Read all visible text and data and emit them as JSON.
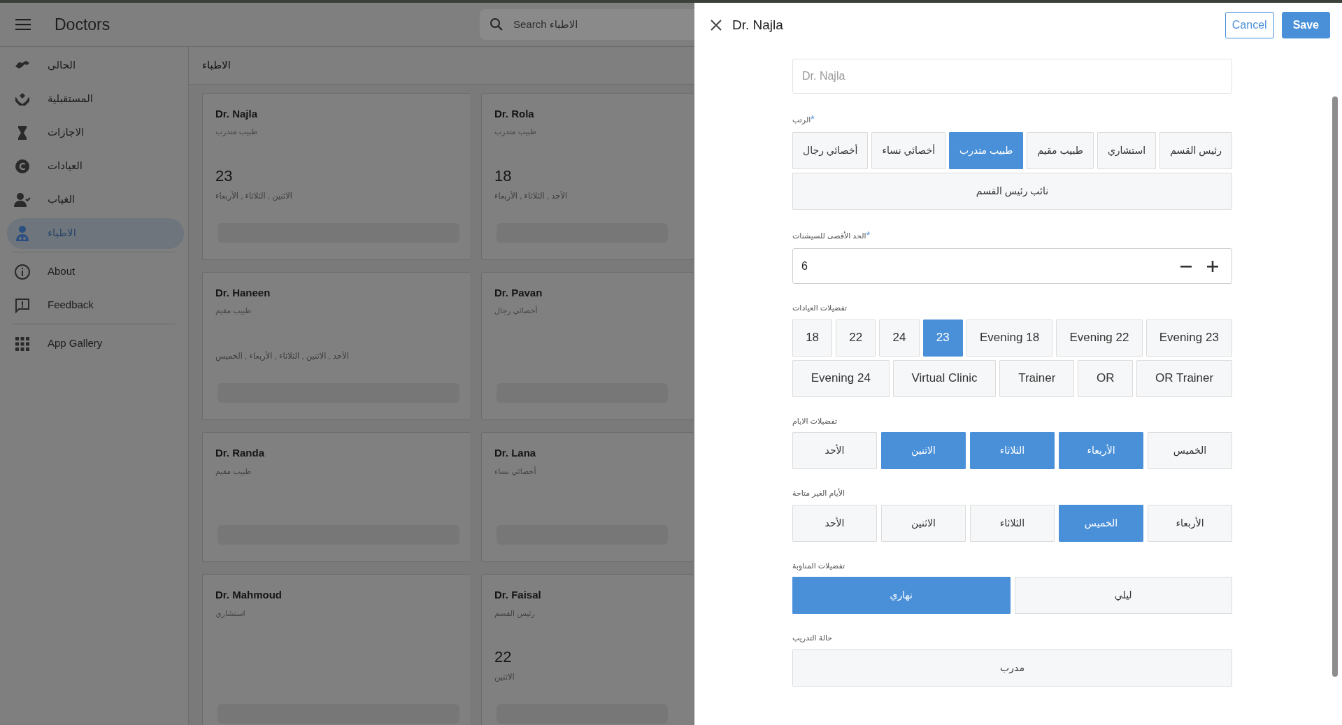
{
  "header": {
    "title": "Doctors",
    "search": {
      "placeholder": "Search الاطباء"
    }
  },
  "sidebar": {
    "groups": [
      [
        {
          "label": "الحالى",
          "selected": false
        },
        {
          "label": "المستقبلية",
          "selected": false
        },
        {
          "label": "الاجازات",
          "selected": false
        },
        {
          "label": "العيادات",
          "selected": false
        },
        {
          "label": "الغياب",
          "selected": false
        },
        {
          "label": "الاطباء",
          "selected": true
        }
      ],
      [
        {
          "label": "About",
          "selected": false
        },
        {
          "label": "Feedback",
          "selected": false
        }
      ],
      [
        {
          "label": "App Gallery",
          "selected": false
        }
      ]
    ]
  },
  "main": {
    "title": "الاطباء",
    "cards": [
      {
        "name": "Dr. Rola",
        "rank": "طبيب متدرب",
        "clinic": "18",
        "days": "الأحد , الثلاثاء , الأربعاء"
      },
      {
        "name": "Dr. Najla",
        "rank": "طبيب متدرب",
        "clinic": "23",
        "days": "الاثنين , الثلاثاء , الأربعاء"
      },
      {
        "name": "Dr. Pavan",
        "rank": "أخصائي رجال"
      },
      {
        "name": "Dr. Haneen",
        "rank": "طبيب مقيم",
        "days": "الأحد , الاثنين , الثلاثاء , الأربعاء , الخميس"
      },
      {
        "name": "Dr. Lana",
        "rank": "أخصائي نساء"
      },
      {
        "name": "Dr. Randa",
        "rank": "طبيب مقيم"
      },
      {
        "name": "Dr. Faisal",
        "rank": "رئيس القسم",
        "clinic": "22",
        "days": "الاثنين"
      },
      {
        "name": "Dr. Mahmoud",
        "rank": "استشاري"
      }
    ]
  },
  "drawer": {
    "title": "Dr. Najla",
    "buttons": [
      {
        "label": "Save",
        "kind": "primary"
      },
      {
        "label": "Cancel",
        "kind": "outline"
      }
    ],
    "name_field": {
      "placeholder": "Dr. Najla"
    },
    "sections": [
      {
        "kind": "chips",
        "label": "الرتب",
        "required_mark": "*",
        "options": [
          {
            "label": "رئيس القسم",
            "selected": false
          },
          {
            "label": "استشاري",
            "selected": false
          },
          {
            "label": "طبيب مقيم",
            "selected": false
          },
          {
            "label": "طبيب متدرب",
            "selected": true
          },
          {
            "label": "أخصائي نساء",
            "selected": false
          },
          {
            "label": "أخصائي رجال",
            "selected": false
          },
          {
            "label": "نائب رئيس القسم",
            "selected": false
          }
        ]
      },
      {
        "kind": "stepper",
        "label": "الحد الأقصى للسيشنات",
        "required_mark": "*",
        "value": "6"
      },
      {
        "kind": "chips",
        "label": "تفضيلات العيادات",
        "options": [
          {
            "label": "Evening 23",
            "selected": false
          },
          {
            "label": "Evening 22",
            "selected": false
          },
          {
            "label": "Evening 18",
            "selected": false
          },
          {
            "label": "23",
            "selected": true
          },
          {
            "label": "24",
            "selected": false
          },
          {
            "label": "22",
            "selected": false
          },
          {
            "label": "18",
            "selected": false
          },
          {
            "label": "OR Trainer",
            "selected": false
          },
          {
            "label": "OR",
            "selected": false
          },
          {
            "label": "Trainer",
            "selected": false
          },
          {
            "label": "Virtual Clinic",
            "selected": false
          },
          {
            "label": "Evening 24",
            "selected": false
          }
        ]
      },
      {
        "kind": "segments",
        "label": "تفضيلات الايام",
        "options": [
          {
            "label": "الخميس",
            "selected": false
          },
          {
            "label": "الأربعاء",
            "selected": true
          },
          {
            "label": "الثلاثاء",
            "selected": true
          },
          {
            "label": "الاثنين",
            "selected": true
          },
          {
            "label": "الأحد",
            "selected": false
          }
        ]
      },
      {
        "kind": "segments",
        "label": "الأيام الغير متاحة",
        "options": [
          {
            "label": "الأربعاء",
            "selected": false
          },
          {
            "label": "الخميس",
            "selected": true
          },
          {
            "label": "الثلاثاء",
            "selected": false
          },
          {
            "label": "الاثنين",
            "selected": false
          },
          {
            "label": "الأحد",
            "selected": false
          }
        ]
      },
      {
        "kind": "segments",
        "label": "تفضيلات المناوبة",
        "options": [
          {
            "label": "ليلي",
            "selected": false
          },
          {
            "label": "نهاري",
            "selected": true
          }
        ]
      },
      {
        "kind": "segments",
        "label": "حالة التدريب",
        "options": [
          {
            "label": "مدرب",
            "selected": false
          }
        ]
      }
    ]
  }
}
